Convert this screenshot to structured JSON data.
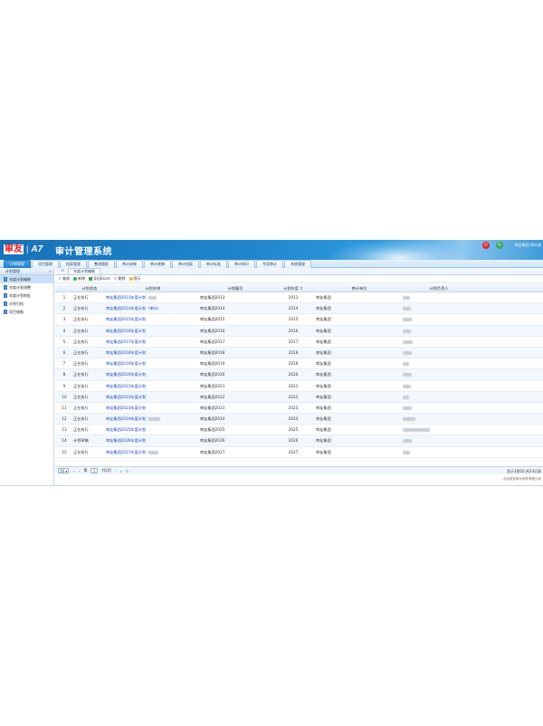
{
  "header": {
    "logo_mark": "审友",
    "logo_sep": "|",
    "logo_product": "A7",
    "system_title": "审计管理系统",
    "user_info": "审友集团 审计部"
  },
  "menu": [
    {
      "label": "计划管理",
      "active": true
    },
    {
      "label": "项目管理"
    },
    {
      "label": "档案管理"
    },
    {
      "label": "整改跟踪"
    },
    {
      "label": "审计成果"
    },
    {
      "label": "审计底稿"
    },
    {
      "label": "审计档案"
    },
    {
      "label": "审计标准"
    },
    {
      "label": "审计知识"
    },
    {
      "label": "专项审计"
    },
    {
      "label": "系统管理"
    }
  ],
  "sidebar": {
    "title": "计划管理",
    "close": "×",
    "items": [
      {
        "label": "年度计划编制",
        "active": true
      },
      {
        "label": "年度计划调整"
      },
      {
        "label": "年度计划审批"
      },
      {
        "label": "计划归档"
      },
      {
        "label": "项目储备"
      }
    ]
  },
  "tabs": {
    "home": "⌂",
    "items": [
      "年度计划编制"
    ]
  },
  "toolbar": [
    {
      "label": "查询",
      "icon": "search-icon",
      "glyph": "⚲"
    },
    {
      "label": "新增",
      "icon": "add-icon",
      "glyph": ""
    },
    {
      "label": "导出Excel",
      "icon": "excel-icon",
      "glyph": ""
    },
    {
      "label": "删除",
      "icon": "delete-icon",
      "glyph": "✕"
    },
    {
      "label": "提示",
      "icon": "hint-icon",
      "glyph": ""
    }
  ],
  "grid": {
    "columns": [
      "计划状态",
      "计划名称",
      "计划编号",
      "计划年度 ↕",
      "审计单位",
      "计划负责人"
    ],
    "rows": [
      {
        "no": "1",
        "status": "正在执行",
        "name": "审友集团2013年度计划（",
        "code": "审友集团2013",
        "year": "2013",
        "unit": "审友集团"
      },
      {
        "no": "2",
        "status": "正在执行",
        "name": "审友集团2014年度计划（审计）",
        "code": "审友集团2014",
        "year": "2014",
        "unit": "审友集团"
      },
      {
        "no": "3",
        "status": "正在执行",
        "name": "审友集团2015年度计划",
        "code": "审友集团2015",
        "year": "2015",
        "unit": "审友集团"
      },
      {
        "no": "4",
        "status": "正在执行",
        "name": "审友集团2016年度计划",
        "code": "审友集团2016",
        "year": "2016",
        "unit": "审友集团"
      },
      {
        "no": "5",
        "status": "正在执行",
        "name": "审友集团2017年度计划",
        "code": "审友集团2017",
        "year": "2017",
        "unit": "审友集团"
      },
      {
        "no": "6",
        "status": "正在执行",
        "name": "审友集团2018年度计划",
        "code": "审友集团2018",
        "year": "2018",
        "unit": "审友集团"
      },
      {
        "no": "7",
        "status": "正在执行",
        "name": "审友集团2019年度计划",
        "code": "审友集团2019",
        "year": "2019",
        "unit": "审友集团"
      },
      {
        "no": "8",
        "status": "正在执行",
        "name": "审友集团2020年度计划",
        "code": "审友集团2020",
        "year": "2020",
        "unit": "审友集团"
      },
      {
        "no": "9",
        "status": "正在执行",
        "name": "审友集团2021年度计划",
        "code": "审友集团2021",
        "year": "2021",
        "unit": "审友集团"
      },
      {
        "no": "10",
        "status": "正在执行",
        "name": "审友集团2022年度计划",
        "code": "审友集团2022",
        "year": "2022",
        "unit": "审友集团"
      },
      {
        "no": "11",
        "status": "正在执行",
        "name": "审友集团2023年度计划",
        "code": "审友集团2023",
        "year": "2023",
        "unit": "审友集团"
      },
      {
        "no": "12",
        "status": "正在执行",
        "name": "审友集团2024年度计划（",
        "code": "审友集团2024",
        "year": "2024",
        "unit": "审友集团"
      },
      {
        "no": "13",
        "status": "正在执行",
        "name": "审友集团2025年度计划",
        "code": "审友集团2025",
        "year": "2025",
        "unit": "审友集团"
      },
      {
        "no": "14",
        "status": "计划草稿",
        "name": "审友集团2026年度计划",
        "code": "审友集团2026",
        "year": "2026",
        "unit": "审友集团"
      },
      {
        "no": "15",
        "status": "正在执行",
        "name": "审友集团2027年度计划（",
        "code": "审友集团2027",
        "year": "2027",
        "unit": "审友集团"
      }
    ]
  },
  "pager": {
    "page_size": "20",
    "first": "«",
    "prev": "‹",
    "page_label": "第",
    "page_value": "1",
    "total_pages": "共2页",
    "next": "›",
    "last": "»",
    "refresh": "↻",
    "info": "显示1到20,共23记录"
  },
  "footer": "北京用友审计软件有限公司"
}
